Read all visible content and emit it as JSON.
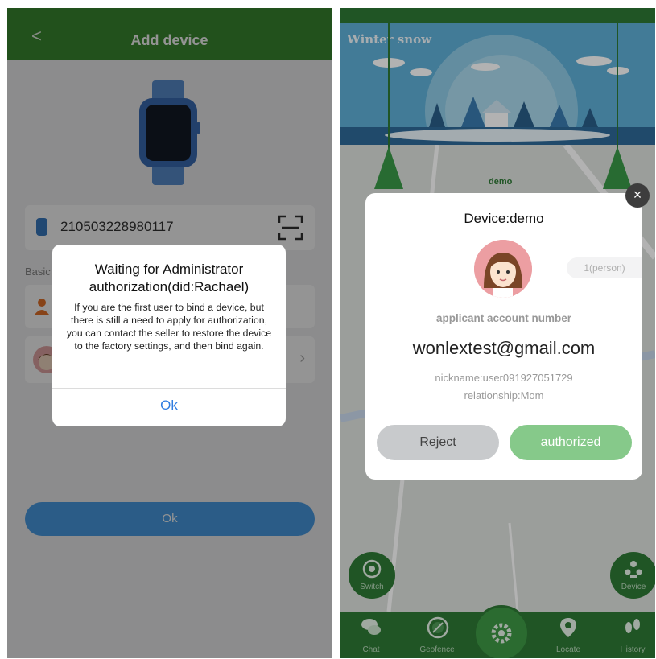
{
  "left_screen": {
    "header": {
      "back_icon": "chevron-left-icon",
      "back_glyph": "<",
      "title": "Add device"
    },
    "device_id": "210503228980117",
    "section_label": "Basic",
    "ok_button": "Ok",
    "dialog": {
      "title": "Waiting for Administrator authorization(did:Rachael)",
      "body": "If you are the first user to bind a device, but there is still a need to apply for authorization, you can contact the seller to restore the device to the factory settings, and then bind again.",
      "ok": "Ok"
    },
    "colors": {
      "header": "#3b8c31",
      "button": "#4a9fe8",
      "link": "#2f7de1"
    }
  },
  "right_screen": {
    "banner_title": "Winter snow",
    "marker_label": "demo",
    "dialog": {
      "title": "Device:demo",
      "count_pill": "1(person)",
      "account_label": "applicant account number",
      "email": "wonlextest@gmail.com",
      "nickname": "nickname:user091927051729",
      "relationship": "relationship:Mom",
      "reject": "Reject",
      "authorized": "authorized"
    },
    "fabs": {
      "switch": "Switch",
      "device": "Device"
    },
    "tabs": [
      "Chat",
      "Geofence",
      "Locate",
      "History"
    ],
    "colors": {
      "bar": "#2e7a35",
      "authorized": "#86c98a",
      "reject": "#c8cacc"
    }
  }
}
